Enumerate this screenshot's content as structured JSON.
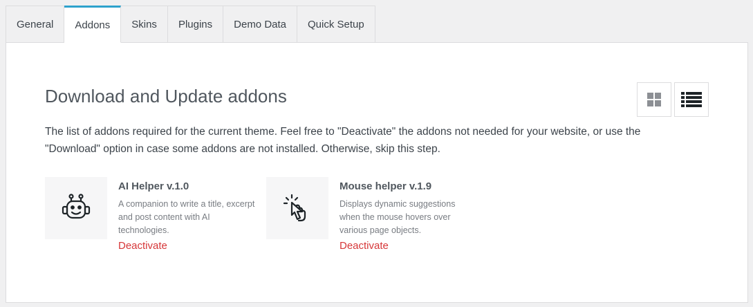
{
  "tabs": [
    {
      "label": "General",
      "active": false
    },
    {
      "label": "Addons",
      "active": true
    },
    {
      "label": "Skins",
      "active": false
    },
    {
      "label": "Plugins",
      "active": false
    },
    {
      "label": "Demo Data",
      "active": false
    },
    {
      "label": "Quick Setup",
      "active": false
    }
  ],
  "main": {
    "title": "Download and Update addons",
    "description": "The list of addons required for the current theme. Feel free to \"Deactivate\" the addons not needed for your website, or use the \"Download\" option in case some addons are not installed. Otherwise, skip this step.",
    "view_toggle": {
      "grid_icon": "grid-view-icon",
      "list_icon": "list-view-icon"
    }
  },
  "addons": [
    {
      "name": "AI Helper v.1.0",
      "description": "A companion to write a title, excerpt and post content with AI technologies.",
      "action": "Deactivate",
      "icon": "robot-icon"
    },
    {
      "name": "Mouse helper v.1.9",
      "description": "Displays dynamic suggestions when the mouse hovers over various page objects.",
      "action": "Deactivate",
      "icon": "pointer-click-icon"
    }
  ],
  "colors": {
    "accent": "#2ea2cc",
    "deactivate": "#d63638"
  }
}
